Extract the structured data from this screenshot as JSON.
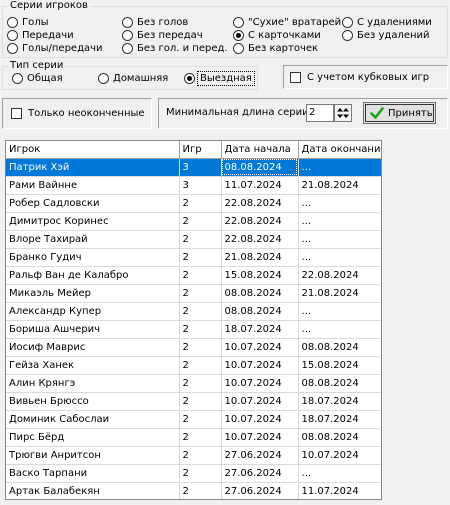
{
  "series_group": {
    "legend": "Серии игроков",
    "options": [
      {
        "label": "Голы",
        "checked": false
      },
      {
        "label": "Передачи",
        "checked": false
      },
      {
        "label": "Голы/передачи",
        "checked": false
      },
      {
        "label": "Без голов",
        "checked": false
      },
      {
        "label": "Без передач",
        "checked": false
      },
      {
        "label": "Без гол. и перед.",
        "checked": false
      },
      {
        "label": "\"Сухие\" вратарей",
        "checked": false
      },
      {
        "label": "С карточками",
        "checked": true
      },
      {
        "label": "Без карточек",
        "checked": false
      },
      {
        "label": "С удалениями",
        "checked": false
      },
      {
        "label": "Без удалений",
        "checked": false
      }
    ]
  },
  "series_type": {
    "legend": "Тип серии",
    "options": [
      {
        "label": "Общая",
        "checked": false
      },
      {
        "label": "Домашняя",
        "checked": false
      },
      {
        "label": "Выездная",
        "checked": true
      }
    ]
  },
  "cup_games_checkbox": {
    "label": "С учетом кубковых игр",
    "checked": false
  },
  "unfinished_checkbox": {
    "label": "Только неоконченные",
    "checked": false
  },
  "min_length": {
    "label": "Минимальная длина серии",
    "value": "2"
  },
  "accept_button": {
    "label": "Принять",
    "icon": "check-icon"
  },
  "table": {
    "columns": [
      "Игрок",
      "Игр",
      "Дата начала",
      "Дата окончания"
    ],
    "selected_row": 0,
    "rows": [
      [
        "Патрик Хэй",
        "3",
        "08.08.2024",
        "..."
      ],
      [
        "Рами Вайнне",
        "3",
        "11.07.2024",
        "21.08.2024"
      ],
      [
        "Робер Садловски",
        "2",
        "22.08.2024",
        "..."
      ],
      [
        "Димитрос Коринес",
        "2",
        "22.08.2024",
        "..."
      ],
      [
        "Влоре Тахирай",
        "2",
        "22.08.2024",
        "..."
      ],
      [
        "Бранко Гудич",
        "2",
        "21.08.2024",
        "..."
      ],
      [
        "Ральф Ван де Калабро",
        "2",
        "15.08.2024",
        "22.08.2024"
      ],
      [
        "Микаэль Мейер",
        "2",
        "08.08.2024",
        "21.08.2024"
      ],
      [
        "Александр Купер",
        "2",
        "08.08.2024",
        "..."
      ],
      [
        "Бориша Ашчерич",
        "2",
        "18.07.2024",
        "..."
      ],
      [
        "Иосиф Маврис",
        "2",
        "10.07.2024",
        "08.08.2024"
      ],
      [
        "Гейза Ханек",
        "2",
        "10.07.2024",
        "15.08.2024"
      ],
      [
        "Алин Крянгэ",
        "2",
        "10.07.2024",
        "08.08.2024"
      ],
      [
        "Вивьен Брюссо",
        "2",
        "10.07.2024",
        "18.07.2024"
      ],
      [
        "Доминик Сабослаи",
        "2",
        "10.07.2024",
        "18.07.2024"
      ],
      [
        "Пирс Бёрд",
        "2",
        "10.07.2024",
        "08.08.2024"
      ],
      [
        "Трюгви Анритсон",
        "2",
        "27.06.2024",
        "10.07.2024"
      ],
      [
        "Васко Тарпани",
        "2",
        "27.06.2024",
        "..."
      ],
      [
        "Артак Балабекян",
        "2",
        "27.06.2024",
        "11.07.2024"
      ]
    ]
  }
}
